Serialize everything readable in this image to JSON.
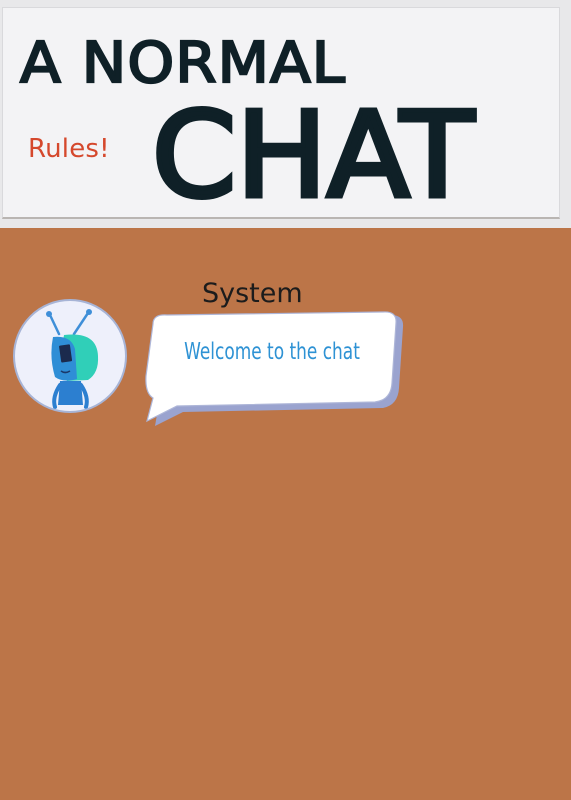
{
  "header": {
    "title_line1": "A NORMAL",
    "title_line2": "CHAT",
    "rules_label": "Rules!"
  },
  "chat": {
    "messages": [
      {
        "sender": "System",
        "text": "Welcome to the chat",
        "avatar_icon": "blue-robot-avatar-icon"
      }
    ]
  },
  "colors": {
    "background": "#bc7548",
    "header_bg": "#f3f3f5",
    "rules_link": "#d5482c",
    "bubble_text": "#2e92d4",
    "title_ink": "#0f2027"
  }
}
